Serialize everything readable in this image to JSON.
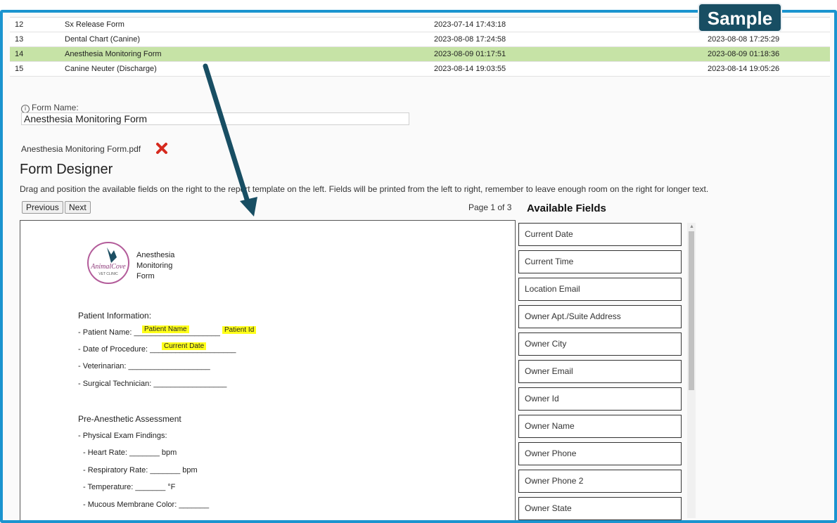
{
  "badge": "Sample",
  "table": {
    "rows": [
      {
        "id": "12",
        "name": "Sx Release Form",
        "created": "2023-07-14 17:43:18",
        "modified": ""
      },
      {
        "id": "13",
        "name": "Dental Chart (Canine)",
        "created": "2023-08-08 17:24:58",
        "modified": "2023-08-08 17:25:29"
      },
      {
        "id": "14",
        "name": "Anesthesia Monitoring Form",
        "created": "2023-08-09 01:17:51",
        "modified": "2023-08-09 01:18:36",
        "selected": true
      },
      {
        "id": "15",
        "name": "Canine Neuter (Discharge)",
        "created": "2023-08-14 19:03:55",
        "modified": "2023-08-14 19:05:26"
      }
    ]
  },
  "form": {
    "info_icon": "info-icon",
    "name_label": "Form Name:",
    "name_value": "Anesthesia Monitoring Form",
    "pdf_file": "Anesthesia Monitoring Form.pdf",
    "delete_icon": "red-x-icon"
  },
  "designer": {
    "title": "Form Designer",
    "description": "Drag and position the available fields on the right to the report template on the left. Fields will be printed from the left to right, remember to leave enough room on the right for longer text.",
    "prev_label": "Previous",
    "next_label": "Next",
    "page_indicator": "Page 1 of 3"
  },
  "template": {
    "logo_line1": "Anesthesia",
    "logo_line2": "Monitoring",
    "logo_line3": "Form",
    "patient_heading": "Patient Information:",
    "patient_name": "- Patient Name: ____________________",
    "tag_patient_name": "Patient Name",
    "tag_patient_id": "Patient Id",
    "procedure_date": "- Date of Procedure: ____________________",
    "tag_current_date": "Current Date",
    "veterinarian": "- Veterinarian: ___________________",
    "surgical_tech": "- Surgical Technician: _________________",
    "pre_heading": "Pre-Anesthetic Assessment",
    "physical_exam": "- Physical Exam Findings:",
    "heart_rate": "- Heart Rate: _______ bpm",
    "resp_rate": "- Respiratory Rate: _______ bpm",
    "temperature": "- Temperature: _______ °F",
    "mucous": "- Mucous Membrane Color: _______"
  },
  "available_fields": {
    "title": "Available Fields",
    "items": [
      "Current Date",
      "Current Time",
      "Location Email",
      "Owner Apt./Suite Address",
      "Owner City",
      "Owner Email",
      "Owner Id",
      "Owner Name",
      "Owner Phone",
      "Owner Phone 2",
      "Owner State"
    ]
  },
  "colors": {
    "accent": "#1b94cf",
    "selected_row": "#c6e3a6",
    "highlight": "#ffff1a",
    "arrow": "#184e63"
  }
}
